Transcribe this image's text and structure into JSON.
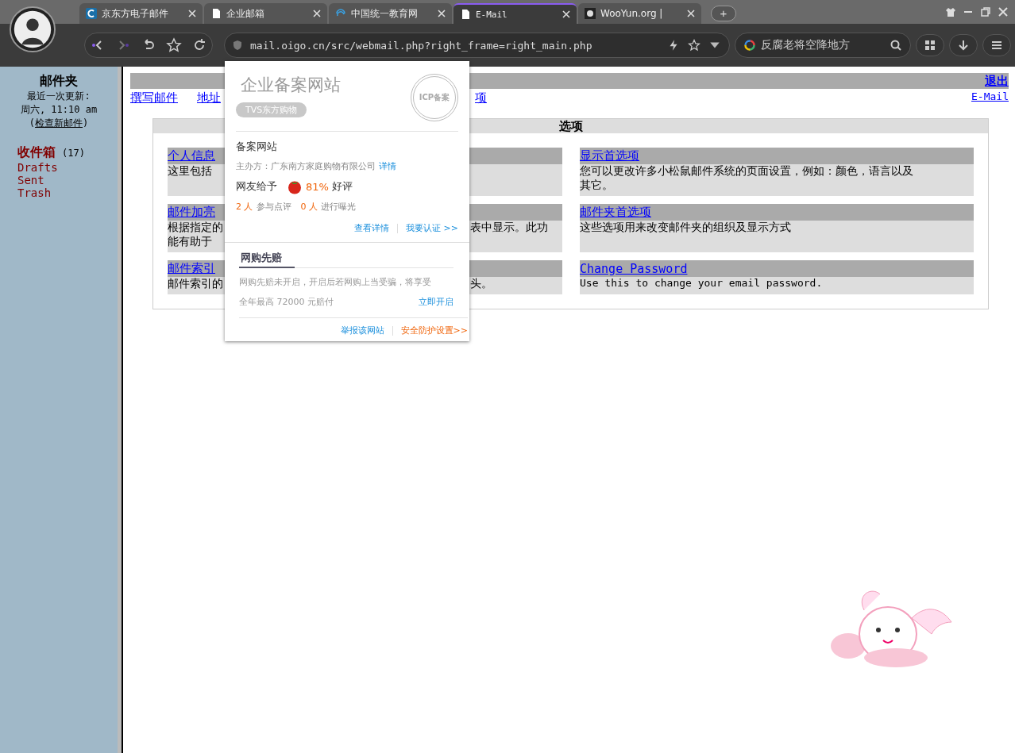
{
  "browser": {
    "tabs": [
      {
        "label": "京东方电子邮件",
        "selected": false
      },
      {
        "label": "企业邮箱",
        "selected": false
      },
      {
        "label": "中国统一教育网",
        "selected": false
      },
      {
        "label": "E-Mail",
        "selected": true
      },
      {
        "label": "WooYun.org | ",
        "selected": false
      }
    ],
    "new_tab": "+",
    "address": "mail.oigo.cn/src/webmail.php?right_frame=right_main.php",
    "search": "反腐老将空降地方"
  },
  "sidebar": {
    "title": "邮件夹",
    "updated_label": "最近一次更新:",
    "updated_time": "周六, 11:10 am",
    "check_open": "(",
    "check_link": "检查新邮件",
    "check_close": ")",
    "folders": [
      {
        "name": "收件箱",
        "count": "(17)",
        "kind": "main"
      },
      {
        "name": "Drafts",
        "kind": "plain"
      },
      {
        "name": "Sent",
        "kind": "plain"
      },
      {
        "name": "Trash",
        "kind": "plain"
      }
    ]
  },
  "main": {
    "logout": "退出",
    "nav": [
      "撰写邮件",
      "地址",
      "项"
    ],
    "brand_link": "E-Mail",
    "options_title": "选项",
    "options": [
      {
        "title": "个人信息",
        "desc": [
          [
            "这里包括"
          ]
        ]
      },
      {
        "title": "显示首选项",
        "desc": [
          [
            "您可以更改许多小松鼠邮件系统的页面设置，例如：颜色，语言以及"
          ],
          [
            "其它。"
          ]
        ]
      },
      {
        "title": "邮件加亮",
        "desc": [
          [
            "根据指定的",
            "表中显示。此功"
          ],
          [
            "能有助于"
          ]
        ]
      },
      {
        "title": "邮件夹首选项",
        "desc": [
          [
            "这些选项用来改变邮件夹的组织及显示方式"
          ]
        ]
      },
      {
        "title": "邮件索引",
        "desc": [
          [
            "邮件索引的",
            "头。"
          ]
        ]
      },
      {
        "title": "Change Password",
        "desc": [
          [
            "Use this to change your email password."
          ]
        ],
        "mono": true
      }
    ]
  },
  "popup": {
    "title": "企业备案网站",
    "seal": "ICP备案",
    "site_badge": "TVS东方购物",
    "section": "备案网站",
    "sponsor": "主办方：广东南方家庭购物有限公司",
    "sponsor_link": "详情",
    "rating_prefix": "网友给予",
    "rating": "81%",
    "rating_suffix": "好评",
    "reviewers": "2 人",
    "reviewers_text": "参与点评",
    "exposers": "0 人",
    "exposers_text": "进行曝光",
    "details_link": "查看详情",
    "certify_link": "我要认证 >>",
    "guarantee_tab": "网购先赔",
    "guarantee_text": "网购先赔未开启，开启后若网购上当受骗，将享受",
    "guarantee_amount": "全年最高  72000  元赔付",
    "enable_link": "立即开启",
    "report_link": "举报该网站",
    "security_link": "安全防护设置>>"
  }
}
